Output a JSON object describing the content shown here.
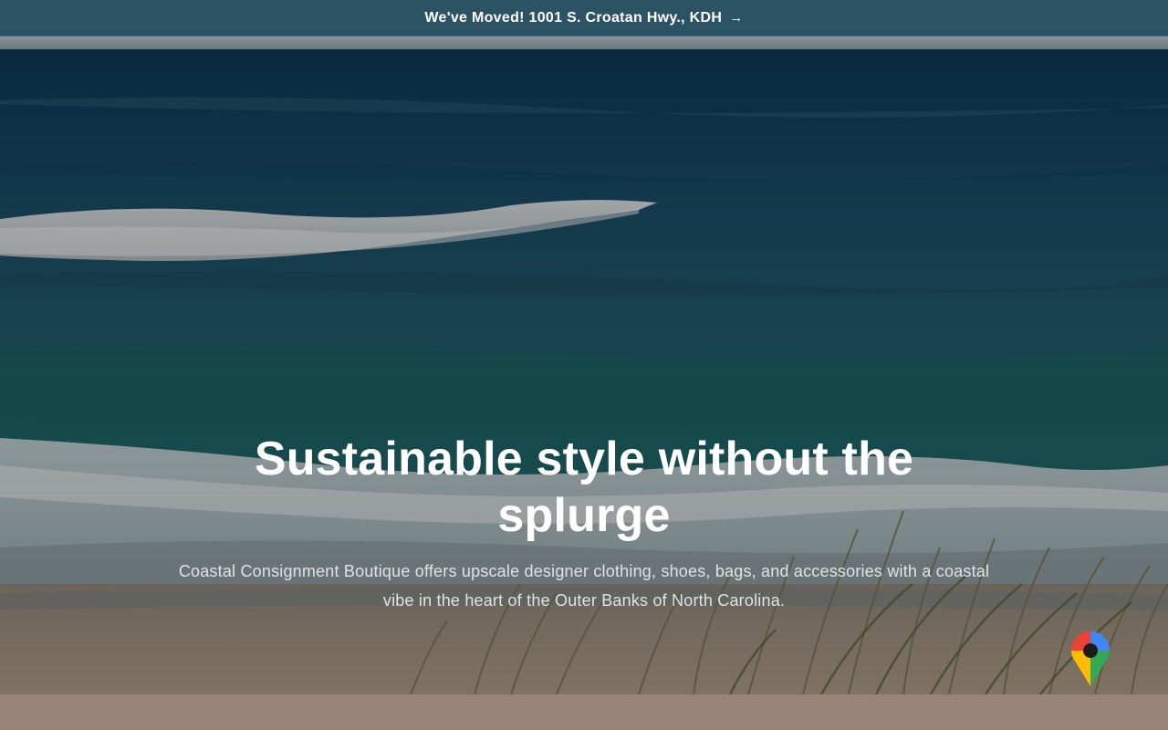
{
  "announcement": {
    "text": "We've Moved! 1001 S. Croatan Hwy., KDH",
    "arrow": "→"
  },
  "hero": {
    "title": "Sustainable style without the splurge",
    "subtitle": "Coastal Consignment Boutique offers upscale designer clothing, shoes, bags, and accessories with a coastal vibe in the heart of the Outer Banks of North Carolina."
  },
  "icons": {
    "map_pin": "google-maps-pin-icon",
    "arrow": "arrow-right-icon"
  },
  "colors": {
    "announcement_bg": "#2b5364",
    "bottom_band": "#9a8477",
    "text_primary": "#ffffff"
  }
}
